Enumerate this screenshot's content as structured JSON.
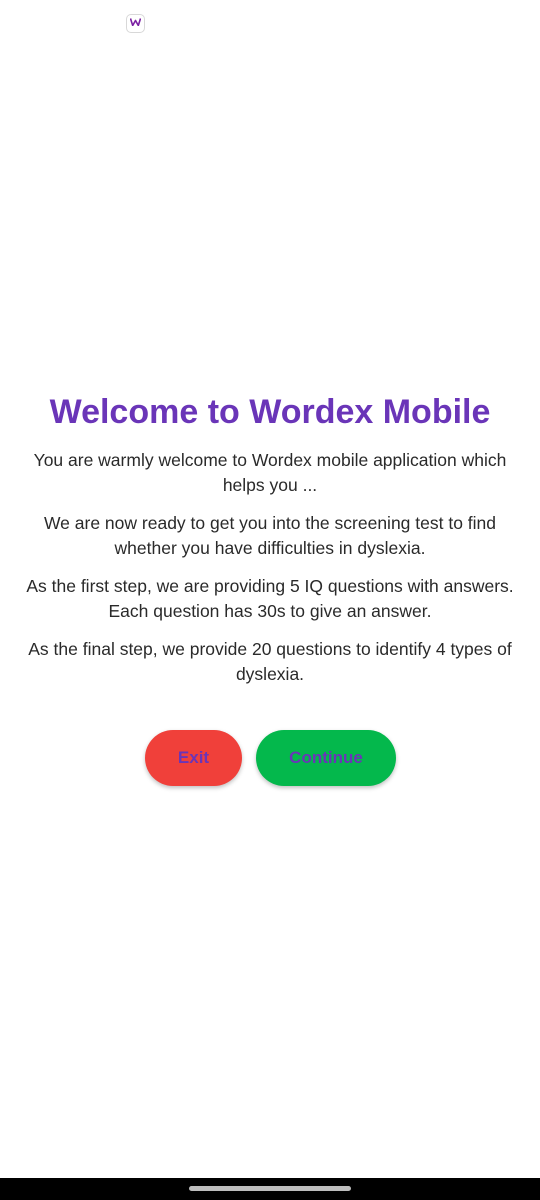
{
  "status_bar": {
    "app_icon": "wordex-logo-icon",
    "app_icon_letter": "W",
    "app_icon_color": "#7a1fa2"
  },
  "welcome": {
    "title": "Welcome to Wordex Mobile",
    "paragraphs": [
      "You are warmly welcome to Wordex mobile application which helps you ...",
      "We are now ready to get you into the screening test to find whether you have difficulties in dyslexia.",
      "As the first step, we are providing 5 IQ questions with answers. Each question has 30s to give an answer.",
      "As the final step, we provide 20 questions to identify 4 types of dyslexia."
    ]
  },
  "actions": {
    "exit_label": "Exit",
    "continue_label": "Continue"
  },
  "colors": {
    "title": "#6a35b8",
    "button_text": "#6a35b8",
    "exit_bg": "#f0403a",
    "continue_bg": "#04b84c"
  },
  "nav_bar": {
    "indicator": "home-indicator"
  }
}
